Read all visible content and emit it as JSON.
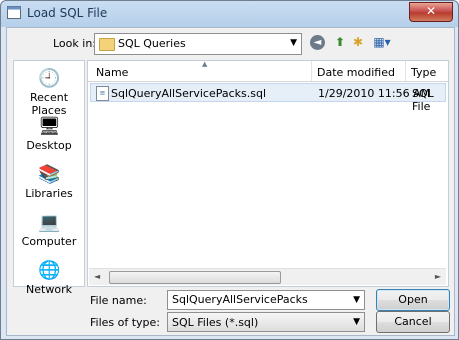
{
  "window": {
    "title": "Load SQL File",
    "close_label": "✕"
  },
  "lookin": {
    "label": "Look in:",
    "value": "SQL Queries"
  },
  "toolbar": {
    "back_glyph": "◄",
    "up_glyph": "⬆",
    "newfolder_glyph": "✱",
    "views_glyph": "▦▾"
  },
  "places": [
    {
      "label": "Recent Places",
      "icon": "recent-places-icon"
    },
    {
      "label": "Desktop",
      "icon": "desktop-icon"
    },
    {
      "label": "Libraries",
      "icon": "libraries-icon"
    },
    {
      "label": "Computer",
      "icon": "computer-icon"
    },
    {
      "label": "Network",
      "icon": "network-icon"
    }
  ],
  "columns": [
    "Name",
    "Date modified",
    "Type"
  ],
  "files": [
    {
      "name": "SqlQueryAllServicePacks.sql",
      "date": "1/29/2010 11:56 AM",
      "type": "SQL File"
    }
  ],
  "filename": {
    "label": "File name:",
    "value": "SqlQueryAllServicePacks"
  },
  "filetype": {
    "label": "Files of type:",
    "value": "SQL Files (*.sql)"
  },
  "buttons": {
    "open": "Open",
    "cancel": "Cancel"
  },
  "colors": {
    "title_text": "#1e395b",
    "selection": "#e6eef8",
    "close_button": "#c75050"
  }
}
